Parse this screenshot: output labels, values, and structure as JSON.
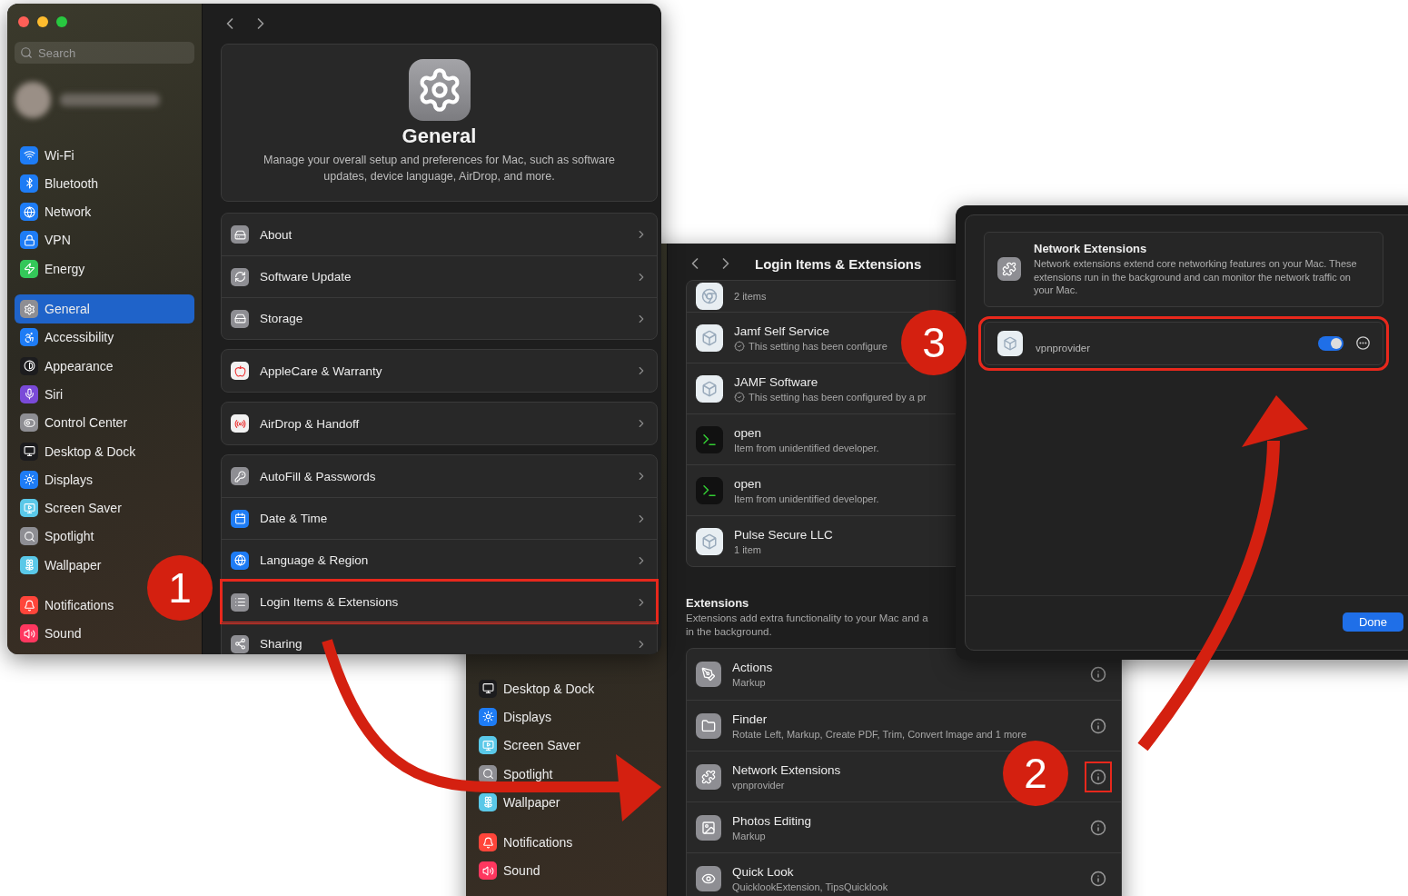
{
  "settings_window": {
    "search": {
      "placeholder": "Search"
    },
    "sidebar": {
      "groups": [
        [
          {
            "label": "Wi-Fi",
            "color": "#1e7cf5",
            "selected": false
          },
          {
            "label": "Bluetooth",
            "color": "#1e7cf5",
            "selected": false
          },
          {
            "label": "Network",
            "color": "#1e7cf5",
            "selected": false
          },
          {
            "label": "VPN",
            "color": "#1e7cf5",
            "selected": false
          },
          {
            "label": "Energy",
            "color": "#34c759",
            "selected": false
          }
        ],
        [
          {
            "label": "General",
            "color": "#8e8e93",
            "selected": true
          },
          {
            "label": "Accessibility",
            "color": "#1e7cf5",
            "selected": false
          },
          {
            "label": "Appearance",
            "color": "#1c1c1e",
            "selected": false
          },
          {
            "label": "Siri",
            "color": "#7a4ad8",
            "selected": false
          },
          {
            "label": "Control Center",
            "color": "#8e8e93",
            "selected": false
          },
          {
            "label": "Desktop & Dock",
            "color": "#1c1c1e",
            "selected": false
          },
          {
            "label": "Displays",
            "color": "#1e7cf5",
            "selected": false
          },
          {
            "label": "Screen Saver",
            "color": "#5ac8e8",
            "selected": false
          },
          {
            "label": "Spotlight",
            "color": "#8e8e93",
            "selected": false
          },
          {
            "label": "Wallpaper",
            "color": "#5ac8e8",
            "selected": false
          }
        ],
        [
          {
            "label": "Notifications",
            "color": "#ff453a",
            "selected": false
          },
          {
            "label": "Sound",
            "color": "#ff375f",
            "selected": false
          }
        ]
      ]
    },
    "header": {
      "title": "General",
      "description": "Manage your overall setup and preferences for Mac, such as software updates, device language, AirDrop, and more."
    },
    "groups": [
      [
        {
          "label": "About",
          "color": "#8e8e93",
          "highlighted": false
        },
        {
          "label": "Software Update",
          "color": "#8e8e93",
          "highlighted": false
        },
        {
          "label": "Storage",
          "color": "#8e8e93",
          "highlighted": false
        }
      ],
      [
        {
          "label": "AppleCare & Warranty",
          "color": "#f2f2f2",
          "highlighted": false
        }
      ],
      [
        {
          "label": "AirDrop & Handoff",
          "color": "#f2f2f2",
          "highlighted": false
        }
      ],
      [
        {
          "label": "AutoFill & Passwords",
          "color": "#8e8e93",
          "highlighted": false
        },
        {
          "label": "Date & Time",
          "color": "#1e7cf5",
          "highlighted": false
        },
        {
          "label": "Language & Region",
          "color": "#1e7cf5",
          "highlighted": false
        },
        {
          "label": "Login Items & Extensions",
          "color": "#8e8e93",
          "highlighted": true
        },
        {
          "label": "Sharing",
          "color": "#8e8e93",
          "highlighted": false
        }
      ]
    ]
  },
  "login_items_window": {
    "title": "Login Items & Extensions",
    "sidebar": {
      "groups": [
        [
          {
            "label": "Desktop & Dock",
            "color": "#1c1c1e",
            "selected": false
          },
          {
            "label": "Displays",
            "color": "#1e7cf5",
            "selected": false
          },
          {
            "label": "Screen Saver",
            "color": "#5ac8e8",
            "selected": false
          },
          {
            "label": "Spotlight",
            "color": "#8e8e93",
            "selected": false
          },
          {
            "label": "Wallpaper",
            "color": "#5ac8e8",
            "selected": false
          }
        ],
        [
          {
            "label": "Notifications",
            "color": "#ff453a",
            "selected": false
          },
          {
            "label": "Sound",
            "color": "#ff375f",
            "selected": false
          }
        ]
      ]
    },
    "login_items": [
      {
        "kind": "chrome",
        "subtitle": "2 items",
        "managed": false
      },
      {
        "kind": "app",
        "title": "Jamf Self Service",
        "subtitle": "This setting has been configure",
        "managed": true
      },
      {
        "kind": "generic",
        "title": "JAMF Software",
        "subtitle": "This setting has been configured by a pr",
        "managed": true
      },
      {
        "kind": "terminal",
        "title": "open",
        "subtitle": "Item from unidentified developer.",
        "managed": false
      },
      {
        "kind": "terminal",
        "title": "open",
        "subtitle": "Item from unidentified developer.",
        "managed": false
      },
      {
        "kind": "generic",
        "title": "Pulse Secure LLC",
        "subtitle": "1 item",
        "managed": false
      }
    ],
    "extensions": {
      "title": "Extensions",
      "description_lines": [
        "Extensions add extra functionality to your Mac and a",
        "in the background."
      ],
      "items": [
        {
          "title": "Actions",
          "subtitle": "Markup",
          "highlighted": false
        },
        {
          "title": "Finder",
          "subtitle": "Rotate Left, Markup, Create PDF, Trim, Convert Image and 1 more",
          "highlighted": false
        },
        {
          "title": "Network Extensions",
          "subtitle": "vpnprovider",
          "highlighted": true
        },
        {
          "title": "Photos Editing",
          "subtitle": "Markup",
          "highlighted": false
        },
        {
          "title": "Quick Look",
          "subtitle": "QuicklookExtension, TipsQuicklook",
          "highlighted": false
        }
      ]
    }
  },
  "network_extensions_sheet": {
    "title": "Network Extensions",
    "description": "Network extensions extend core networking features on your Mac. These extensions run in the background and can monitor the network traffic on your Mac.",
    "items": [
      {
        "name": "vpnprovider",
        "on": true,
        "highlighted": true
      }
    ],
    "done_button": "Done"
  },
  "annotations": [
    {
      "label": "1"
    },
    {
      "label": "2"
    },
    {
      "label": "3"
    }
  ]
}
